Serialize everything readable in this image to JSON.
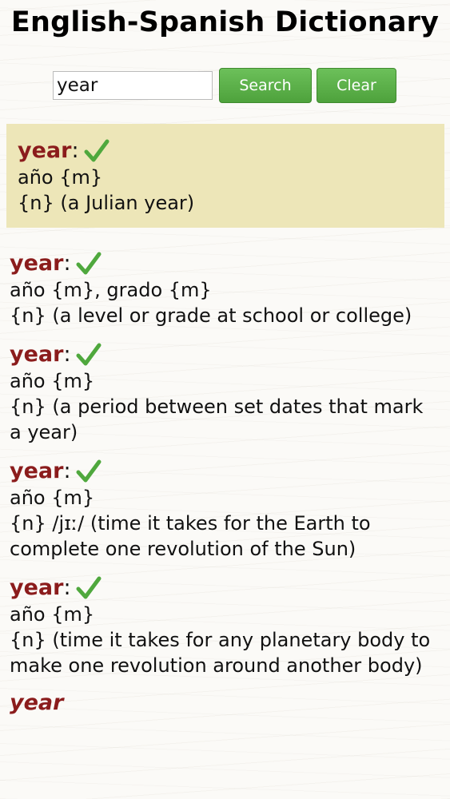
{
  "header": {
    "title": "English-Spanish Dictionary"
  },
  "search": {
    "value": "year",
    "search_label": "Search",
    "clear_label": "Clear"
  },
  "highlight": {
    "headword": "year",
    "colon": ":",
    "translation": "año {m}",
    "definition": "{n} (a Julian year)"
  },
  "entries": [
    {
      "headword": "year",
      "colon": ":",
      "translation": "año {m}, grado {m}",
      "definition": "{n} (a level or grade at school or college)"
    },
    {
      "headword": "year",
      "colon": ":",
      "translation": "año {m}",
      "definition": "{n} (a period between set dates that mark a year)"
    },
    {
      "headword": "year",
      "colon": ":",
      "translation": "año {m}",
      "definition": "{n} /jɪː/ (time it takes for the Earth to complete one revolution of the Sun)"
    },
    {
      "headword": "year",
      "colon": ":",
      "translation": "año {m}",
      "definition": "{n} (time it takes for any planetary body to make one revolution around another body)"
    }
  ],
  "partial_entry": {
    "headword": "year"
  },
  "colors": {
    "headword": "#8b1c1c",
    "button": "#5cb04a",
    "highlight_bg": "#ede6b8",
    "check": "#4fa83d"
  },
  "icons": {
    "check": "check-icon"
  }
}
